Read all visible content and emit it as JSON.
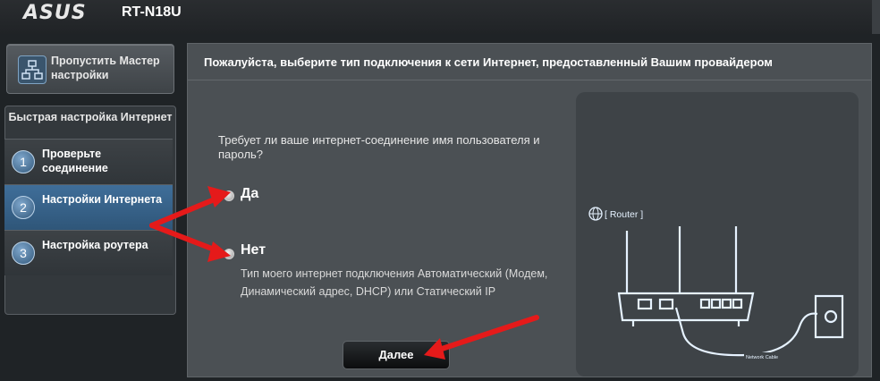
{
  "header": {
    "brand": "ASUS",
    "model": "RT-N18U"
  },
  "sidebar": {
    "wizard_button": "Пропустить Мастер настройки",
    "quick_setup_title": "Быстрая настройка Интернет",
    "steps": [
      {
        "num": "1",
        "label": "Проверьте соединение"
      },
      {
        "num": "2",
        "label": "Настройки Интернета"
      },
      {
        "num": "3",
        "label": "Настройка роутера"
      }
    ],
    "active_step": 2
  },
  "main": {
    "title": "Пожалуйста, выберите тип подключения к сети Интернет, предоставленный Вашим провайдером",
    "question": "Требует ли ваше интернет-соединение имя пользователя и пароль?",
    "options": [
      {
        "label": "Да"
      },
      {
        "label": "Нет",
        "description": "Тип моего интернет подключения Автоматический (Модем, Динамический адрес, DHCP) или Статический IP"
      }
    ],
    "next_button": "Далее"
  },
  "illustration": {
    "router_label": "[ Router ]",
    "cable_label": "Network Cable"
  },
  "colors": {
    "accent_active": "#3a6891",
    "annotation_arrow": "#e51a1a",
    "panel_bg": "#4b5054"
  }
}
